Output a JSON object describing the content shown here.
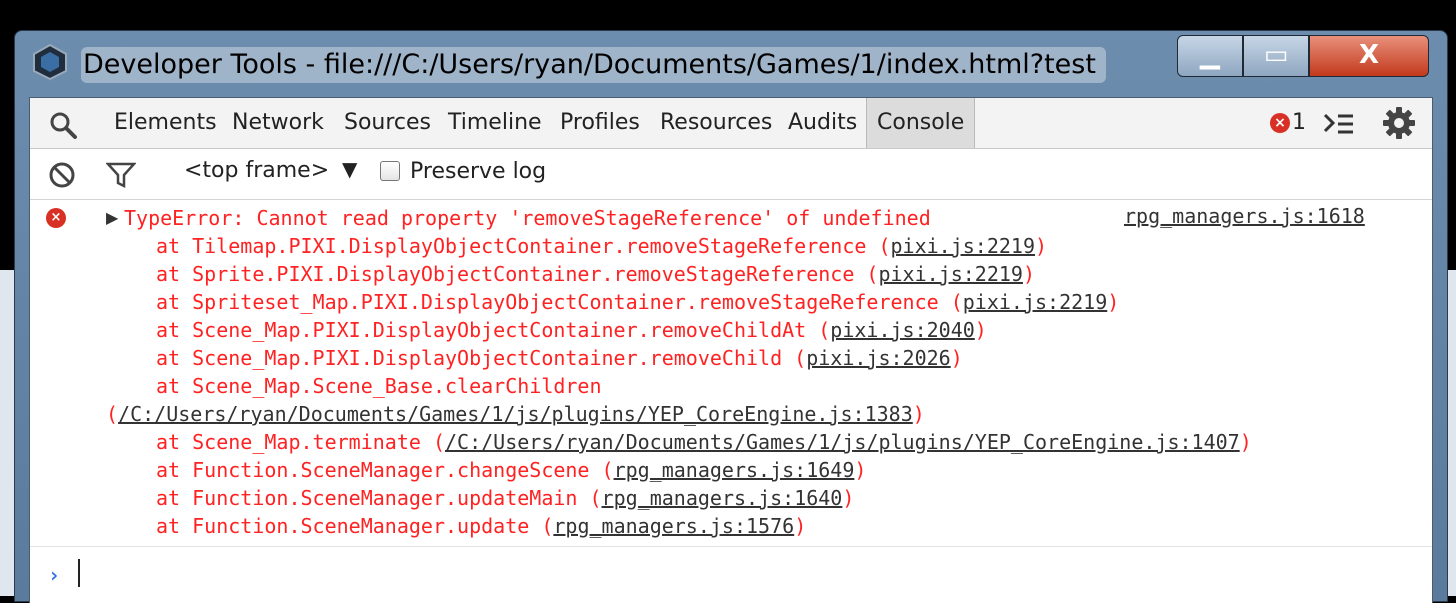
{
  "window": {
    "title": "Developer Tools - file:///C:/Users/ryan/Documents/Games/1/index.html?test",
    "controls": {
      "minimize": "▁",
      "maximize": "▭",
      "close": "X"
    }
  },
  "toolbar": {
    "tabs": [
      "Elements",
      "Network",
      "Sources",
      "Timeline",
      "Profiles",
      "Resources",
      "Audits",
      "Console"
    ],
    "active_tab": "Console",
    "error_icon_glyph": "×",
    "error_count": "1"
  },
  "filterbar": {
    "frame": "<top frame>",
    "frame_arrow": "▼",
    "preserve_log_label": "Preserve log",
    "preserve_log_checked": false
  },
  "console": {
    "error_icon_glyph": "×",
    "disclosure": "▶",
    "message": "TypeError: Cannot read property 'removeStageReference' of undefined",
    "source": "rpg_managers.js:1618",
    "stack": [
      {
        "text": "at Tilemap.PIXI.DisplayObjectContainer.removeStageReference (",
        "link": "pixi.js:2219",
        "close": ")"
      },
      {
        "text": "at Sprite.PIXI.DisplayObjectContainer.removeStageReference (",
        "link": "pixi.js:2219",
        "close": ")"
      },
      {
        "text": "at Spriteset_Map.PIXI.DisplayObjectContainer.removeStageReference (",
        "link": "pixi.js:2219",
        "close": ")"
      },
      {
        "text": "at Scene_Map.PIXI.DisplayObjectContainer.removeChildAt (",
        "link": "pixi.js:2040",
        "close": ")"
      },
      {
        "text": "at Scene_Map.PIXI.DisplayObjectContainer.removeChild (",
        "link": "pixi.js:2026",
        "close": ")"
      },
      {
        "text": "at Scene_Map.Scene_Base.clearChildren",
        "link": "",
        "close": ""
      },
      {
        "text": "(",
        "link": "/C:/Users/ryan/Documents/Games/1/js/plugins/YEP_CoreEngine.js:1383",
        "close": ")"
      },
      {
        "text": "at Scene_Map.terminate (",
        "link": "/C:/Users/ryan/Documents/Games/1/js/plugins/YEP_CoreEngine.js:1407",
        "close": ")"
      },
      {
        "text": "at Function.SceneManager.changeScene (",
        "link": "rpg_managers.js:1649",
        "close": ")"
      },
      {
        "text": "at Function.SceneManager.updateMain (",
        "link": "rpg_managers.js:1640",
        "close": ")"
      },
      {
        "text": "at Function.SceneManager.update (",
        "link": "rpg_managers.js:1576",
        "close": ")"
      }
    ],
    "prompt": "›"
  }
}
